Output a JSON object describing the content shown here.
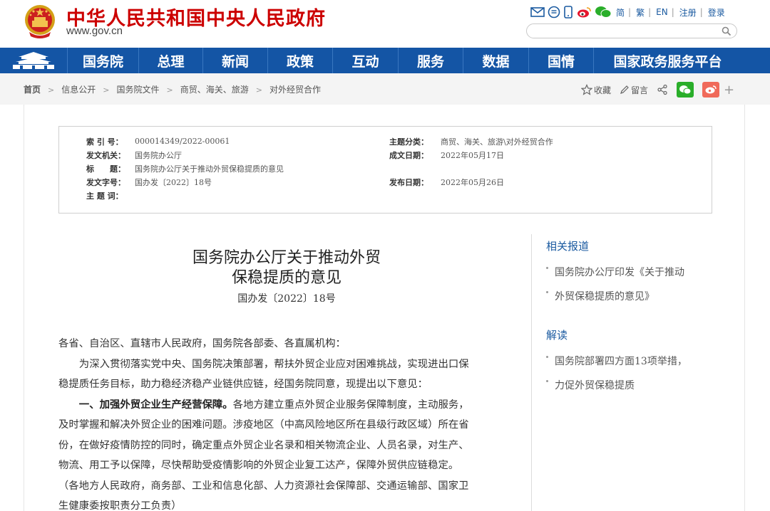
{
  "header": {
    "site_name": "中华人民共和国中央人民政府",
    "site_url": "www.gov.cn",
    "lang": [
      "简",
      "繁",
      "EN",
      "注册",
      "登录"
    ],
    "search_placeholder": ""
  },
  "nav": {
    "items": [
      "国务院",
      "总理",
      "新闻",
      "政策",
      "互动",
      "服务",
      "数据",
      "国情",
      "国家政务服务平台"
    ]
  },
  "breadcrumb": {
    "items": [
      "首页",
      "信息公开",
      "国务院文件",
      "商贸、海关、旅游",
      "对外经贸合作"
    ]
  },
  "tools": {
    "favorite": "收藏",
    "comment": "留言",
    "more": "+"
  },
  "meta": {
    "left": [
      {
        "k": "索 引 号：",
        "v": "000014349/2022-00061"
      },
      {
        "k": "发文机关：",
        "v": "国务院办公厅"
      },
      {
        "k": "标　　题：",
        "v": "国务院办公厅关于推动外贸保稳提质的意见"
      },
      {
        "k": "发文字号：",
        "v": "国办发〔2022〕18号"
      },
      {
        "k": "主 题 词：",
        "v": ""
      }
    ],
    "right": [
      {
        "k": "主题分类：",
        "v": "商贸、海关、旅游\\对外经贸合作"
      },
      {
        "k": "成文日期：",
        "v": "2022年05月17日"
      },
      {
        "k": "",
        "v": ""
      },
      {
        "k": "发布日期：",
        "v": "2022年05月26日"
      }
    ]
  },
  "article": {
    "title_line1": "国务院办公厅关于推动外贸",
    "title_line2": "保稳提质的意见",
    "doc_number": "国办发〔2022〕18号",
    "salutation": "各省、自治区、直辖市人民政府，国务院各部委、各直属机构：",
    "intro_1": "为深入贯彻落实党中央、国务院决策部署，帮扶外贸企业应对困难挑战，实现进出口保",
    "intro_2": "稳提质任务目标，助力稳经济稳产业链供应链，经国务院同意，现提出以下意见：",
    "sec1_head": "一、加强外贸企业生产经营保障。",
    "sec1_a": "各地方建立重点外贸企业服务保障制度，主动服务，",
    "sec1_b": "及时掌握和解决外贸企业的困难问题。涉疫地区（中高风险地区所在县级行政区域）所在省",
    "sec1_c": "份，在做好疫情防控的同时，确定重点外贸企业名录和相关物流企业、人员名录，对生产、",
    "sec1_d": "物流、用工予以保障，尽快帮助受疫情影响的外贸企业复工达产，保障外贸供应链稳定。",
    "sec1_e": "（各地方人民政府，商务部、工业和信息化部、人力资源社会保障部、交通运输部、国家卫",
    "sec1_f": "生健康委按职责分工负责）"
  },
  "sidebar": {
    "related_title": "相关报道",
    "related": [
      "国务院办公厅印发《关于推动",
      "外贸保稳提质的意见》"
    ],
    "reading_title": "解读",
    "reading": [
      "国务院部署四方面13项举措，",
      "力促外贸保稳提质"
    ]
  },
  "colors": {
    "brand_red": "#cc0000",
    "nav_blue": "#1455a5",
    "link_blue": "#1a5aa0"
  }
}
